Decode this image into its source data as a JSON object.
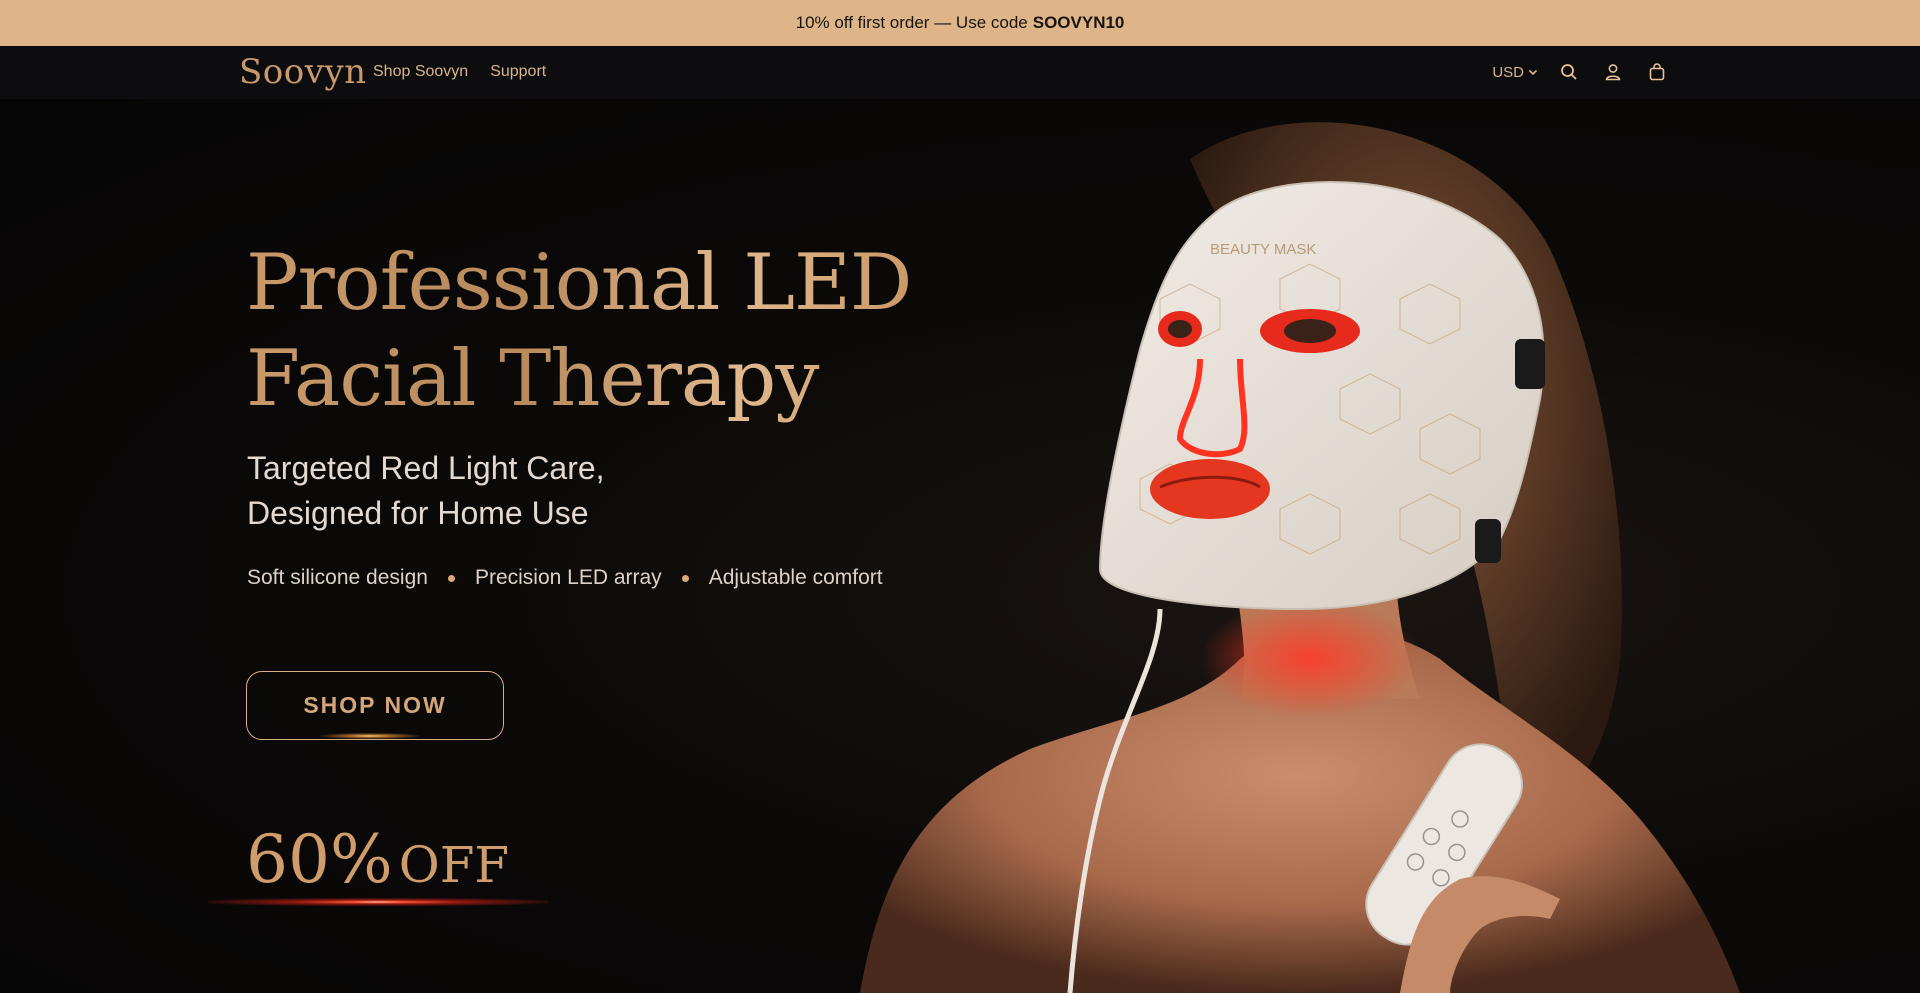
{
  "announcement": {
    "text": "10% off first order — Use code",
    "code": "SOOVYN10",
    "bg": "#deb588"
  },
  "header": {
    "logo": "Soovyn",
    "nav": [
      {
        "label": "Shop Soovyn"
      },
      {
        "label": "Support"
      }
    ],
    "currency": "USD",
    "icons": [
      "search-icon",
      "account-icon",
      "cart-icon"
    ]
  },
  "hero": {
    "headline_line1": "Professional LED",
    "headline_line2": "Facial Therapy",
    "subhead_line1": "Targeted Red Light Care,",
    "subhead_line2": "Designed for Home Use",
    "features": [
      "Soft silicone design",
      "Precision LED array",
      "Adjustable comfort"
    ],
    "cta_label": "SHOP NOW",
    "discount_pct": "60%",
    "discount_off": "OFF",
    "mask_brand": "BEAUTY MASK",
    "accent": "#d4a679"
  }
}
